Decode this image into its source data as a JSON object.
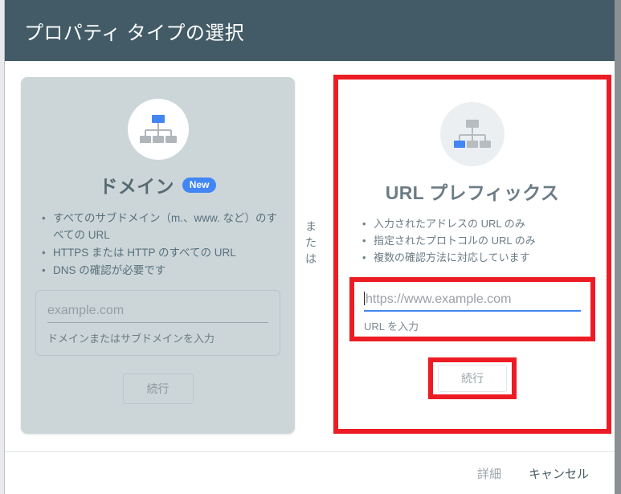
{
  "header": {
    "title": "プロパティ タイプの選択",
    "bg_color": "#425b66"
  },
  "divider": {
    "line1": "また",
    "line2": "は"
  },
  "domain_card": {
    "icon_name": "sitemap-icon",
    "title": "ドメイン",
    "badge": "New",
    "bullets": [
      "すべてのサブドメイン（m.、www. など）のすべての URL",
      "HTTPS または HTTP のすべての URL",
      "DNS の確認が必要です"
    ],
    "input": {
      "placeholder": "example.com",
      "value": "",
      "helper": "ドメインまたはサブドメインを入力"
    },
    "continue_label": "続行",
    "bg_color": "#ccd6d9"
  },
  "url_card": {
    "icon_name": "sitemap-icon",
    "title": "URL プレフィックス",
    "bullets": [
      "入力されたアドレスの URL のみ",
      "指定されたプロトコルの URL のみ",
      "複数の確認方法に対応しています"
    ],
    "input": {
      "placeholder": "https://www.example.com",
      "value": "",
      "helper": "URL を入力"
    },
    "continue_label": "続行",
    "highlight_color": "#ed1c24",
    "focus_color": "#4285f4"
  },
  "footer": {
    "details_label": "詳細",
    "cancel_label": "キャンセル"
  }
}
